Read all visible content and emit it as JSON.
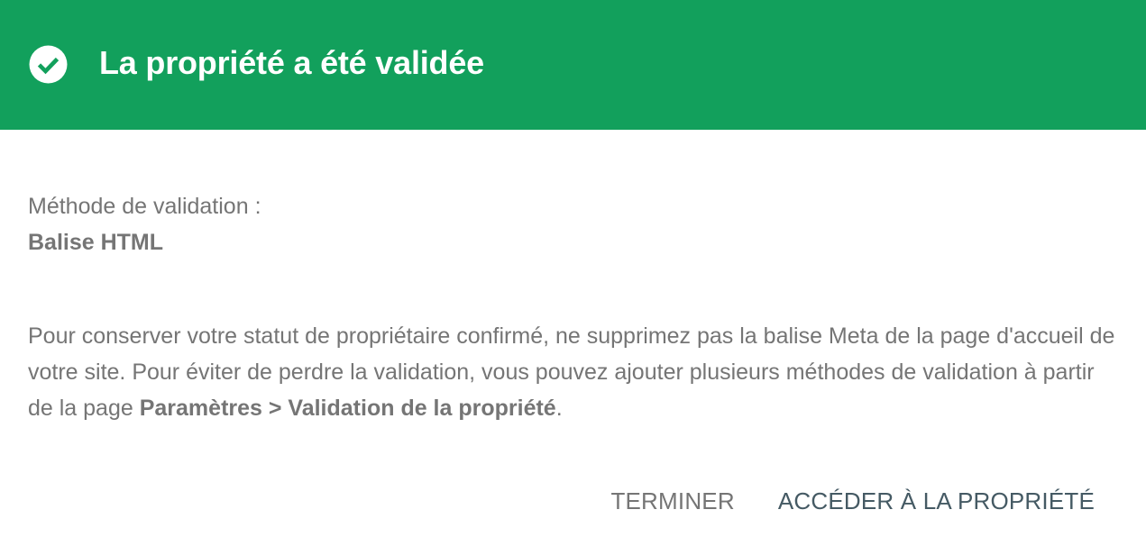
{
  "header": {
    "icon": "check-circle-icon",
    "title": "La propriété a été validée",
    "background_color": "#12a05c"
  },
  "method": {
    "label": "Méthode de validation :",
    "value": "Balise HTML"
  },
  "description": {
    "text_before": "Pour conserver votre statut de propriétaire confirmé, ne supprimez pas la balise Meta de la page d'accueil de votre site. Pour éviter de perdre la validation, vous pouvez ajouter plusieurs méthodes de validation à partir de la page ",
    "link_text": "Paramètres > Validation de la propriété",
    "text_after": "."
  },
  "actions": {
    "finish_label": "TERMINER",
    "go_to_property_label": "ACCÉDER À LA PROPRIÉTÉ"
  }
}
